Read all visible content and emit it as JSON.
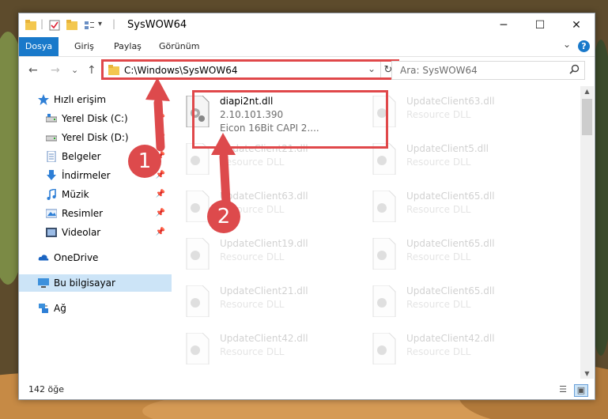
{
  "window": {
    "title": "SysWOW64"
  },
  "window_controls": {
    "minimize": "─",
    "maximize": "☐",
    "close": "✕"
  },
  "ribbon": {
    "tabs": [
      "Dosya",
      "Giriş",
      "Paylaş",
      "Görünüm"
    ],
    "active_tab": "Dosya",
    "expand": "⌄",
    "help": "?"
  },
  "nav": {
    "back": "←",
    "forward": "→",
    "recent": "⌄",
    "up": "↑",
    "address": "C:\\Windows\\SysWOW64",
    "dropdown": "⌄",
    "refresh": "↻",
    "search_placeholder": "Ara: SysWOW64"
  },
  "sidebar": {
    "items": [
      {
        "label": "Hızlı erişim",
        "icon": "star-icon",
        "pinned": false
      },
      {
        "label": "Yerel Disk (C:)",
        "icon": "drive-icon",
        "pinned": true
      },
      {
        "label": "Yerel Disk (D:)",
        "icon": "drive-icon",
        "pinned": true
      },
      {
        "label": "Belgeler",
        "icon": "documents-icon",
        "pinned": true
      },
      {
        "label": "İndirmeler",
        "icon": "download-icon",
        "pinned": true
      },
      {
        "label": "Müzik",
        "icon": "music-icon",
        "pinned": true
      },
      {
        "label": "Resimler",
        "icon": "pictures-icon",
        "pinned": true
      },
      {
        "label": "Videolar",
        "icon": "videos-icon",
        "pinned": true
      },
      {
        "label": "OneDrive",
        "icon": "onedrive-icon",
        "pinned": false
      },
      {
        "label": "Bu bilgisayar",
        "icon": "computer-icon",
        "pinned": false
      },
      {
        "label": "Ağ",
        "icon": "network-icon",
        "pinned": false
      }
    ],
    "pin_glyph": "📌"
  },
  "files": [
    {
      "name": "diapi2nt.dll",
      "line2": "2.10.101.390",
      "line3": "Eicon 16Bit CAPI 2....",
      "highlighted": true
    },
    {
      "name": "UpdateClient63.dll",
      "line2": "Resource DLL",
      "line3": ""
    },
    {
      "name": "UpdateClient21.dll",
      "line2": "Resource DLL",
      "line3": ""
    },
    {
      "name": "UpdateClient5.dll",
      "line2": "Resource DLL",
      "line3": ""
    },
    {
      "name": "UpdateClient63.dll",
      "line2": "Resource DLL",
      "line3": ""
    },
    {
      "name": "UpdateClient65.dll",
      "line2": "Resource DLL",
      "line3": ""
    },
    {
      "name": "UpdateClient19.dll",
      "line2": "Resource DLL",
      "line3": ""
    },
    {
      "name": "UpdateClient65.dll",
      "line2": "Resource DLL",
      "line3": ""
    },
    {
      "name": "UpdateClient21.dll",
      "line2": "Resource DLL",
      "line3": ""
    },
    {
      "name": "UpdateClient65.dll",
      "line2": "Resource DLL",
      "line3": ""
    },
    {
      "name": "UpdateClient42.dll",
      "line2": "Resource DLL",
      "line3": ""
    },
    {
      "name": "UpdateClient42.dll",
      "line2": "Resource DLL",
      "line3": ""
    }
  ],
  "status": {
    "count": "142 öğe"
  },
  "annotations": {
    "step1": "1",
    "step2": "2",
    "color": "#dd4a4c"
  }
}
